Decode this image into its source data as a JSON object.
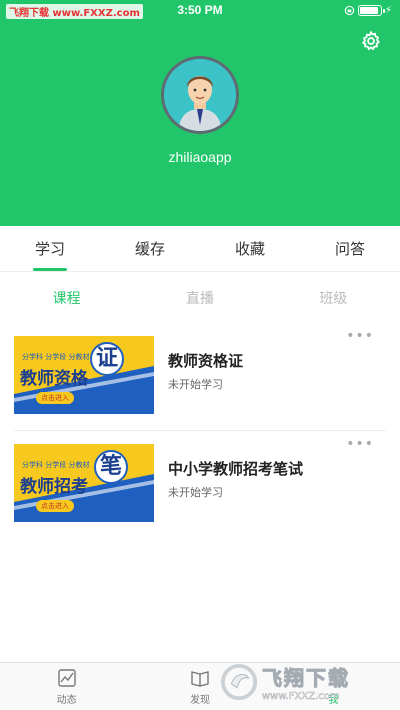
{
  "status_bar": {
    "watermark_text": "飞翔下载 www.FXXZ.com",
    "time": "3:50 PM"
  },
  "profile": {
    "username": "zhiliaoapp"
  },
  "tabs": [
    {
      "label": "学习"
    },
    {
      "label": "缓存"
    },
    {
      "label": "收藏"
    },
    {
      "label": "问答"
    }
  ],
  "subtabs": [
    {
      "label": "课程"
    },
    {
      "label": "直播"
    },
    {
      "label": "班级"
    }
  ],
  "courses": [
    {
      "title": "教师资格证",
      "status": "未开始学习",
      "thumb_text": "教师资格",
      "thumb_big": "证",
      "thumb_tags": "分学科 分学段 分教材",
      "thumb_button": "点击进入"
    },
    {
      "title": "中小学教师招考笔试",
      "status": "未开始学习",
      "thumb_text": "教师招考",
      "thumb_big": "笔",
      "thumb_tags": "分学科 分学段 分教材",
      "thumb_button": "点击进入"
    }
  ],
  "more_label": "•••",
  "bottom_nav": [
    {
      "label": "动态"
    },
    {
      "label": "发现"
    },
    {
      "label": "我"
    }
  ],
  "watermark": {
    "name": "飞翔下载",
    "url": "www.FXXZ.com"
  },
  "colors": {
    "accent": "#21c66a",
    "header_bg": "#21c66a"
  },
  "icons": {
    "settings": "gear-icon",
    "nav_feed": "chart-icon",
    "nav_discover": "book-icon"
  }
}
